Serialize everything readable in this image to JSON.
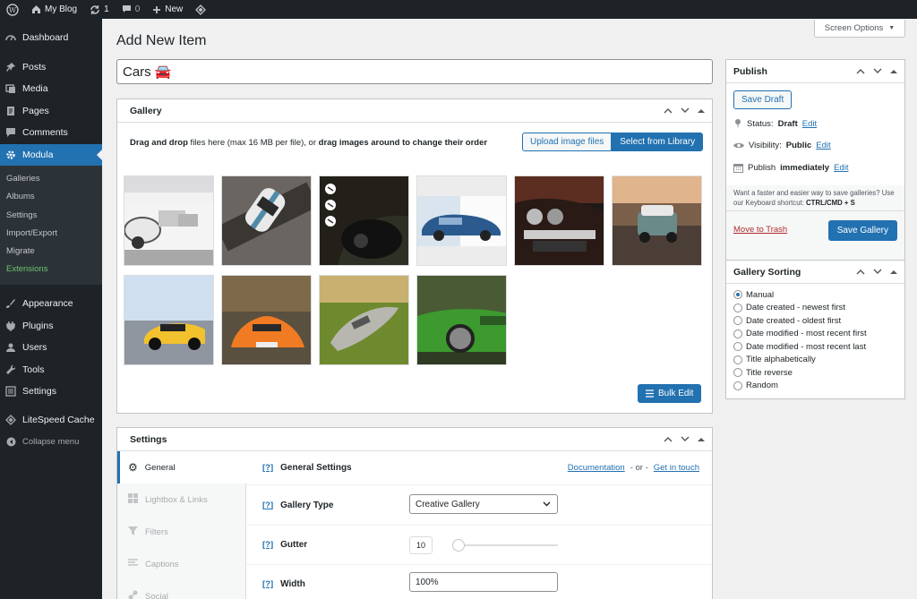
{
  "admin_bar": {
    "site_name": "My Blog",
    "updates_count": "1",
    "comments_count": "0",
    "new_label": "New"
  },
  "sidebar": {
    "items_top": [
      {
        "label": "Dashboard",
        "icon": "dashboard-icon"
      },
      {
        "label": "Posts",
        "icon": "pin-icon"
      },
      {
        "label": "Media",
        "icon": "media-icon"
      },
      {
        "label": "Pages",
        "icon": "pages-icon"
      },
      {
        "label": "Comments",
        "icon": "comment-icon"
      },
      {
        "label": "Modula",
        "icon": "gear-icon"
      }
    ],
    "submenu": [
      "Galleries",
      "Albums",
      "Settings",
      "Import/Export",
      "Migrate",
      "Extensions"
    ],
    "items_bottom": [
      {
        "label": "Appearance",
        "icon": "brush-icon"
      },
      {
        "label": "Plugins",
        "icon": "plugin-icon"
      },
      {
        "label": "Users",
        "icon": "user-icon"
      },
      {
        "label": "Tools",
        "icon": "wrench-icon"
      },
      {
        "label": "Settings",
        "icon": "settings-icon"
      },
      {
        "label": "LiteSpeed Cache",
        "icon": "diamond-icon"
      },
      {
        "label": "Collapse menu",
        "icon": "collapse-icon"
      }
    ]
  },
  "page": {
    "title": "Add New Item",
    "screen_options": "Screen Options",
    "item_title_value": "Cars 🚘"
  },
  "gallery": {
    "heading": "Gallery",
    "dropzone_text_1": "Drag and drop",
    "dropzone_text_2": " files here (max 16 MB per file), or ",
    "dropzone_text_3": "drag images around to change their order",
    "upload_label": "Upload image files",
    "library_label": "Select from Library",
    "bulk_edit_label": "Bulk Edit"
  },
  "settings_box": {
    "heading": "Settings",
    "tabs": [
      "General",
      "Lightbox & Links",
      "Filters",
      "Captions",
      "Social"
    ],
    "general_heading": "General Settings",
    "help_marker": "[?]",
    "documentation_link": "Documentation",
    "or_text": "- or -",
    "get_in_touch_link": "Get in touch",
    "gallery_type_label": "Gallery Type",
    "gallery_type_value": "Creative Gallery",
    "gutter_label": "Gutter",
    "gutter_value": "10",
    "width_label": "Width",
    "width_value": "100%"
  },
  "publish": {
    "heading": "Publish",
    "save_draft": "Save Draft",
    "status_label": "Status:",
    "status_value": "Draft",
    "visibility_label": "Visibility:",
    "visibility_value": "Public",
    "publish_label": "Publish",
    "publish_value": "immediately",
    "edit_link": "Edit",
    "hint_text": "Want a faster and easier way to save galleries? Use our Keyboard shortcut: ",
    "hint_shortcut": "CTRL/CMD + S",
    "trash_link": "Move to Trash",
    "save_gallery": "Save Gallery"
  },
  "sorting": {
    "heading": "Gallery Sorting",
    "options": [
      "Manual",
      "Date created - newest first",
      "Date created - oldest first",
      "Date modified - most recent first",
      "Date modified - most recent last",
      "Title alphabetically",
      "Title reverse",
      "Random"
    ],
    "selected": "Manual"
  },
  "colors": {
    "accent": "#2271b1",
    "admin_dark": "#1d2327",
    "extensions_green": "#6ec26e"
  }
}
